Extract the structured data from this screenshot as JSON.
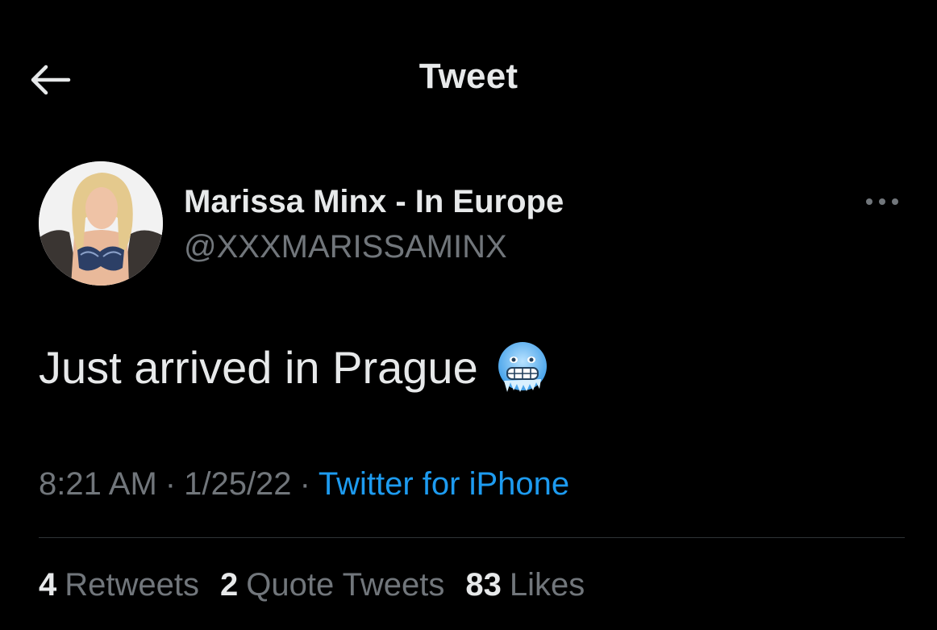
{
  "header": {
    "title": "Tweet",
    "back_icon": "arrow-left-icon"
  },
  "author": {
    "display_name": "Marissa Minx - In Europe",
    "handle": "@XXXMARISSAMINX",
    "more_icon": "more-horizontal-icon"
  },
  "tweet": {
    "text": "Just arrived in Prague",
    "emoji_icon": "cold-face-emoji-icon"
  },
  "meta": {
    "time": "8:21 AM",
    "date": "1/25/22",
    "separator": "·",
    "source": "Twitter for iPhone"
  },
  "stats": {
    "retweets_count": "4",
    "retweets_label": "Retweets",
    "quotes_count": "2",
    "quotes_label": "Quote Tweets",
    "likes_count": "83",
    "likes_label": "Likes"
  },
  "colors": {
    "background": "#000000",
    "primary_text": "#e7e9ea",
    "secondary_text": "#71767b",
    "link": "#1d9bf0",
    "divider": "#2f3336"
  }
}
